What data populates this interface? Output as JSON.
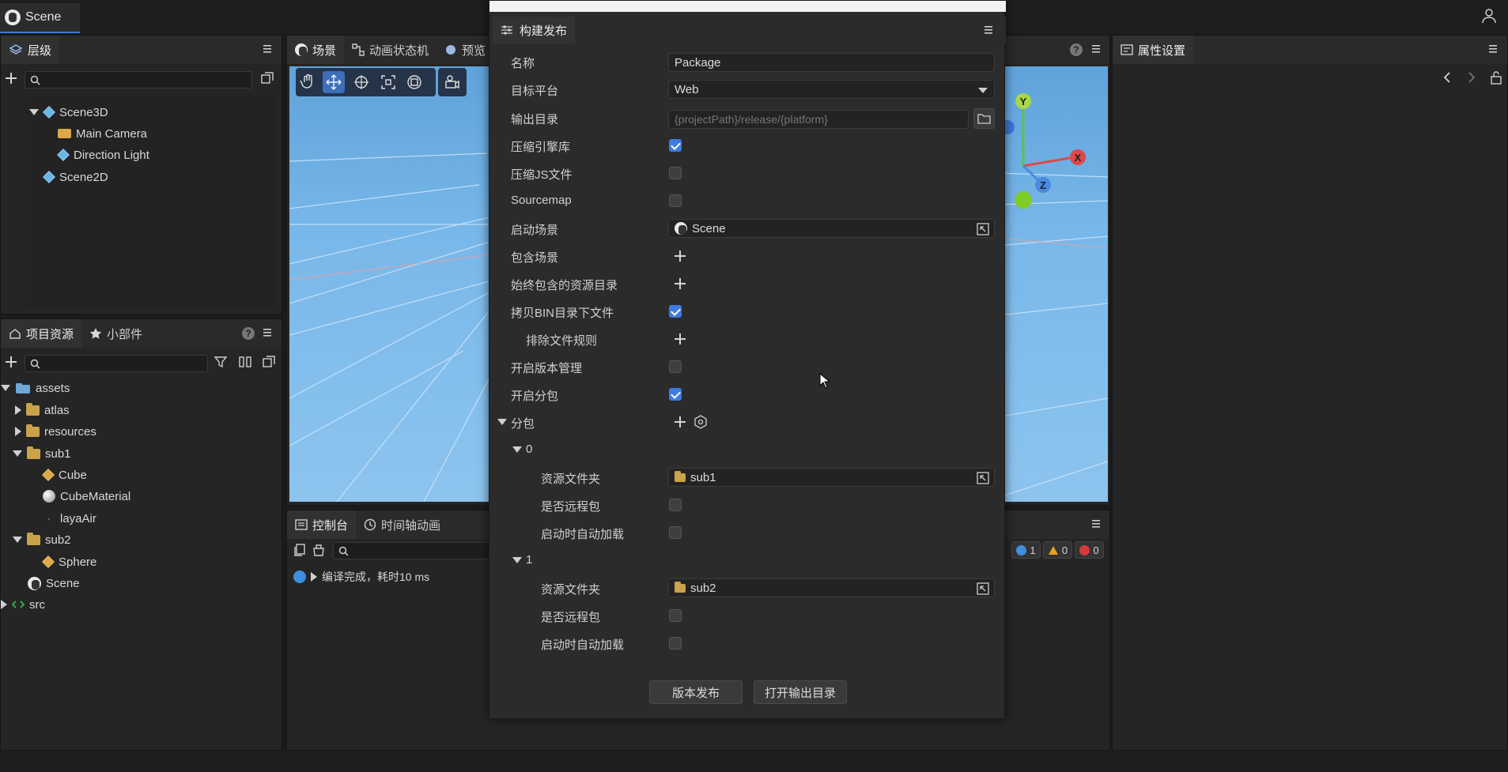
{
  "top": {
    "scene_tab": "Scene"
  },
  "hierarchy": {
    "title": "层级",
    "items": [
      {
        "label": "Scene3D"
      },
      {
        "label": "Main Camera"
      },
      {
        "label": "Direction Light"
      },
      {
        "label": "Scene2D"
      }
    ]
  },
  "scene_panel": {
    "tabs": [
      {
        "label": "场景"
      },
      {
        "label": "动画状态机"
      },
      {
        "label": "预览"
      }
    ]
  },
  "project": {
    "tabs": [
      {
        "label": "项目资源"
      },
      {
        "label": "小部件"
      }
    ],
    "items": [
      {
        "label": "assets"
      },
      {
        "label": "atlas"
      },
      {
        "label": "resources"
      },
      {
        "label": "sub1"
      },
      {
        "label": "Cube"
      },
      {
        "label": "CubeMaterial"
      },
      {
        "label": "layaAir"
      },
      {
        "label": "sub2"
      },
      {
        "label": "Sphere"
      },
      {
        "label": "Scene"
      },
      {
        "label": "src"
      }
    ]
  },
  "console": {
    "tabs": [
      {
        "label": "控制台"
      },
      {
        "label": "时间轴动画"
      }
    ],
    "message": "编译完成，耗时10 ms",
    "counts": {
      "info": "1",
      "warn": "0",
      "error": "0"
    }
  },
  "props": {
    "title": "属性设置"
  },
  "dialog": {
    "tab": "构建发布",
    "fields": {
      "name_label": "名称",
      "name_value": "Package",
      "platform_label": "目标平台",
      "platform_value": "Web",
      "output_label": "输出目录",
      "output_placeholder": "{projectPath}/release/{platform}",
      "compress_engine_label": "压缩引擎库",
      "compress_js_label": "压缩JS文件",
      "sourcemap_label": "Sourcemap",
      "start_scene_label": "启动场景",
      "start_scene_value": "Scene",
      "include_scenes_label": "包含场景",
      "always_include_label": "始终包含的资源目录",
      "copy_bin_label": "拷贝BIN目录下文件",
      "exclude_rules_label": "排除文件规则",
      "version_mgmt_label": "开启版本管理",
      "subpackage_enable_label": "开启分包",
      "subpackage_label": "分包"
    },
    "packages": [
      {
        "index": "0",
        "folder_label": "资源文件夹",
        "folder_value": "sub1",
        "remote_label": "是否远程包",
        "autoload_label": "启动时自动加载"
      },
      {
        "index": "1",
        "folder_label": "资源文件夹",
        "folder_value": "sub2",
        "remote_label": "是否远程包",
        "autoload_label": "启动时自动加载"
      }
    ],
    "buttons": {
      "publish": "版本发布",
      "open_output": "打开输出目录"
    }
  }
}
